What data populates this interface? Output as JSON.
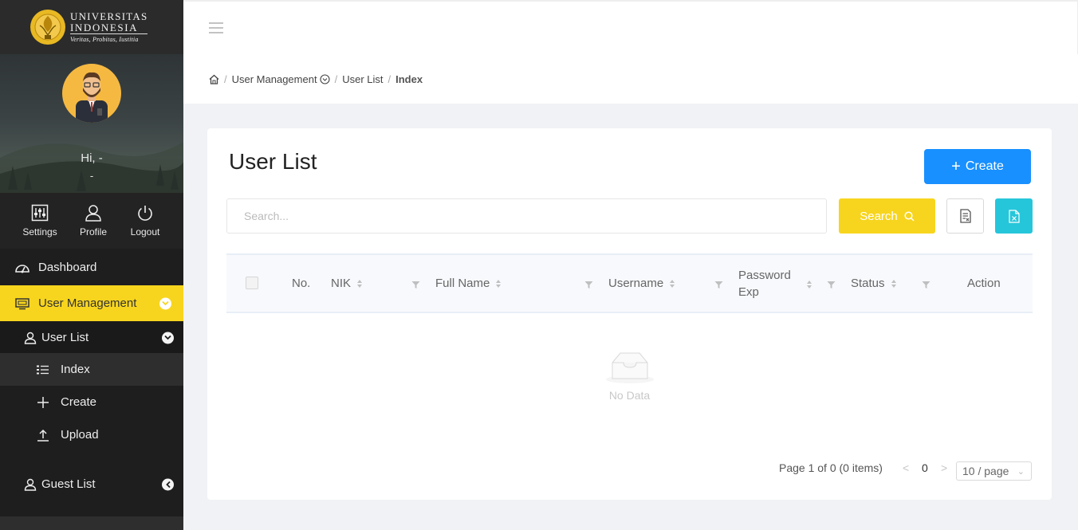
{
  "logo": {
    "line1": "UNIVERSITAS",
    "line2": "INDONESIA",
    "motto": "Veritas, Probitas, Iustitia"
  },
  "profile": {
    "greeting": "Hi, -",
    "subtitle": "-"
  },
  "quick_actions": [
    {
      "label": "Settings",
      "icon": "sliders-icon"
    },
    {
      "label": "Profile",
      "icon": "user-icon"
    },
    {
      "label": "Logout",
      "icon": "power-icon"
    }
  ],
  "sidebar": {
    "dashboard": "Dashboard",
    "user_management": "User Management",
    "user_list": "User List",
    "index": "Index",
    "create": "Create",
    "upload": "Upload",
    "guest_list": "Guest List"
  },
  "breadcrumb": {
    "items": [
      "User Management",
      "User List"
    ],
    "current": "Index"
  },
  "card": {
    "title": "User List",
    "create_label": "Create",
    "search_placeholder": "Search...",
    "search_value": "",
    "search_label": "Search"
  },
  "table": {
    "columns": {
      "no": "No.",
      "nik": "NIK",
      "full_name": "Full Name",
      "username": "Username",
      "password_exp_1": "Password",
      "password_exp_2": "Exp",
      "status": "Status",
      "action": "Action"
    },
    "empty_text": "No Data"
  },
  "pagination": {
    "info": "Page 1 of 0 (0 items)",
    "prev": "<",
    "current": "0",
    "next": ">",
    "page_size": "10 / page"
  },
  "colors": {
    "accent_yellow": "#f7d51e",
    "primary_blue": "#1890ff",
    "teal": "#26c6da",
    "sidebar_bg": "#1e1e1e"
  }
}
